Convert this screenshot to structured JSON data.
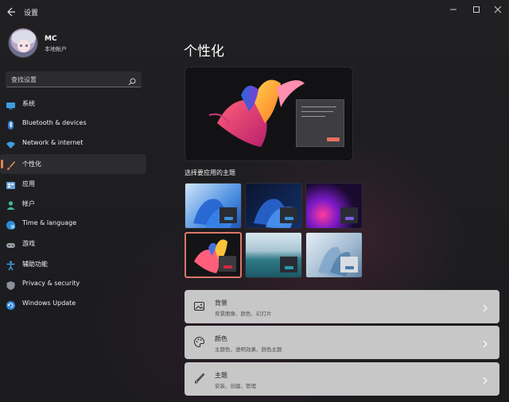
{
  "window": {
    "title": "设置",
    "back_icon": "back-arrow-icon",
    "controls": [
      "—",
      "☐",
      "✕"
    ]
  },
  "profile": {
    "name": "MC",
    "account_type": "本地帐户"
  },
  "search": {
    "placeholder": "查找设置"
  },
  "sidebar": {
    "items": [
      {
        "label": "系统",
        "icon": "system-icon"
      },
      {
        "label": "Bluetooth & devices",
        "icon": "bluetooth-icon"
      },
      {
        "label": "Network & internet",
        "icon": "network-icon"
      },
      {
        "label": "个性化",
        "icon": "brush-icon",
        "active": true
      },
      {
        "label": "应用",
        "icon": "apps-icon"
      },
      {
        "label": "帐户",
        "icon": "account-icon"
      },
      {
        "label": "Time & language",
        "icon": "globe-icon"
      },
      {
        "label": "游戏",
        "icon": "gamepad-icon"
      },
      {
        "label": "辅助功能",
        "icon": "accessibility-icon"
      },
      {
        "label": "Privacy & security",
        "icon": "shield-icon"
      },
      {
        "label": "Windows Update",
        "icon": "update-icon"
      }
    ]
  },
  "main": {
    "title": "个性化",
    "theme_section_label": "选择要应用的主题",
    "themes": [
      {
        "name": "light-bloom",
        "selected": false
      },
      {
        "name": "dark-bloom",
        "selected": false
      },
      {
        "name": "glow",
        "selected": false
      },
      {
        "name": "captured-motion",
        "selected": true
      },
      {
        "name": "sunrise",
        "selected": false
      },
      {
        "name": "flow",
        "selected": false
      }
    ],
    "cards": [
      {
        "title": "背景",
        "subtitle": "背景图像、颜色、幻灯片",
        "icon": "image-icon"
      },
      {
        "title": "颜色",
        "subtitle": "主题色、透明效果、颜色主题",
        "icon": "palette-icon"
      },
      {
        "title": "主题",
        "subtitle": "安装、创建、管理",
        "icon": "brush-icon"
      }
    ]
  },
  "colors": {
    "accent": "#e8834f",
    "selected_border": "#d9776a",
    "card_bg": "#c7c7c7"
  }
}
